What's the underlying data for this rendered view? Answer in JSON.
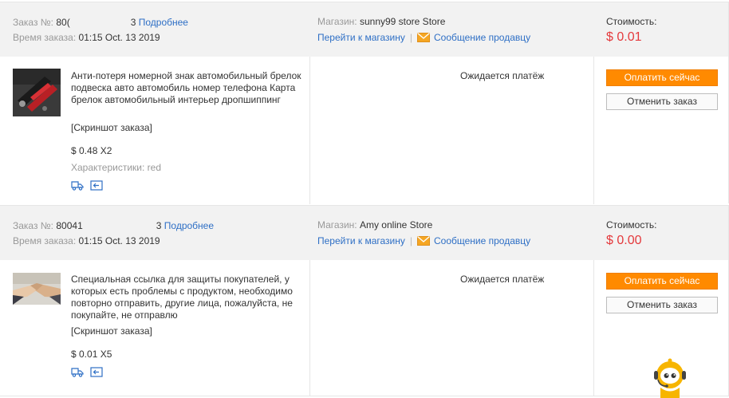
{
  "orders": [
    {
      "order_label": "Заказ №:",
      "order_number_visible": "80(",
      "order_number_tail": "3",
      "details_link": "Подробнее",
      "time_label": "Время заказа:",
      "time_value": "01:15 Oct. 13 2019",
      "shop_label": "Магазин:",
      "shop_name": "sunny99 store Store",
      "go_to_shop": "Перейти к магазину",
      "message_seller": "Сообщение продавцу",
      "cost_label": "Стоимость:",
      "cost_value": "$ 0.01",
      "product_title": "Анти-потеря номерной знак автомобильный брелок подвеска авто автомобиль номер телефона Карта брелок автомобильный интерьер дропшиппинг",
      "snapshot": "[Скриншот заказа]",
      "price_qty": "$ 0.48 X2",
      "characteristics": "Характеристики: red",
      "status": "Ожидается платёж",
      "pay_button": "Оплатить сейчас",
      "cancel_button": "Отменить заказ"
    },
    {
      "order_label": "Заказ №:",
      "order_number_visible": "80041",
      "order_number_tail": "3",
      "details_link": "Подробнее",
      "time_label": "Время заказа:",
      "time_value": "01:15 Oct. 13 2019",
      "shop_label": "Магазин:",
      "shop_name": "Amy online Store",
      "go_to_shop": "Перейти к магазину",
      "message_seller": "Сообщение продавцу",
      "cost_label": "Стоимость:",
      "cost_value": "$ 0.00",
      "product_title": "Специальная ссылка для защиты покупателей, у которых есть проблемы с продуктом, необходимо повторно отправить, другие лица, пожалуйста, не покупайте, не отправлю",
      "snapshot": "[Скриншот заказа]",
      "price_qty": "$ 0.01 X5",
      "status": "Ожидается платёж",
      "pay_button": "Оплатить сейчас",
      "cancel_button": "Отменить заказ"
    }
  ],
  "colors": {
    "accent_orange": "#ff8a00",
    "link_blue": "#2e6fc5",
    "cost_red": "#e4393c"
  }
}
